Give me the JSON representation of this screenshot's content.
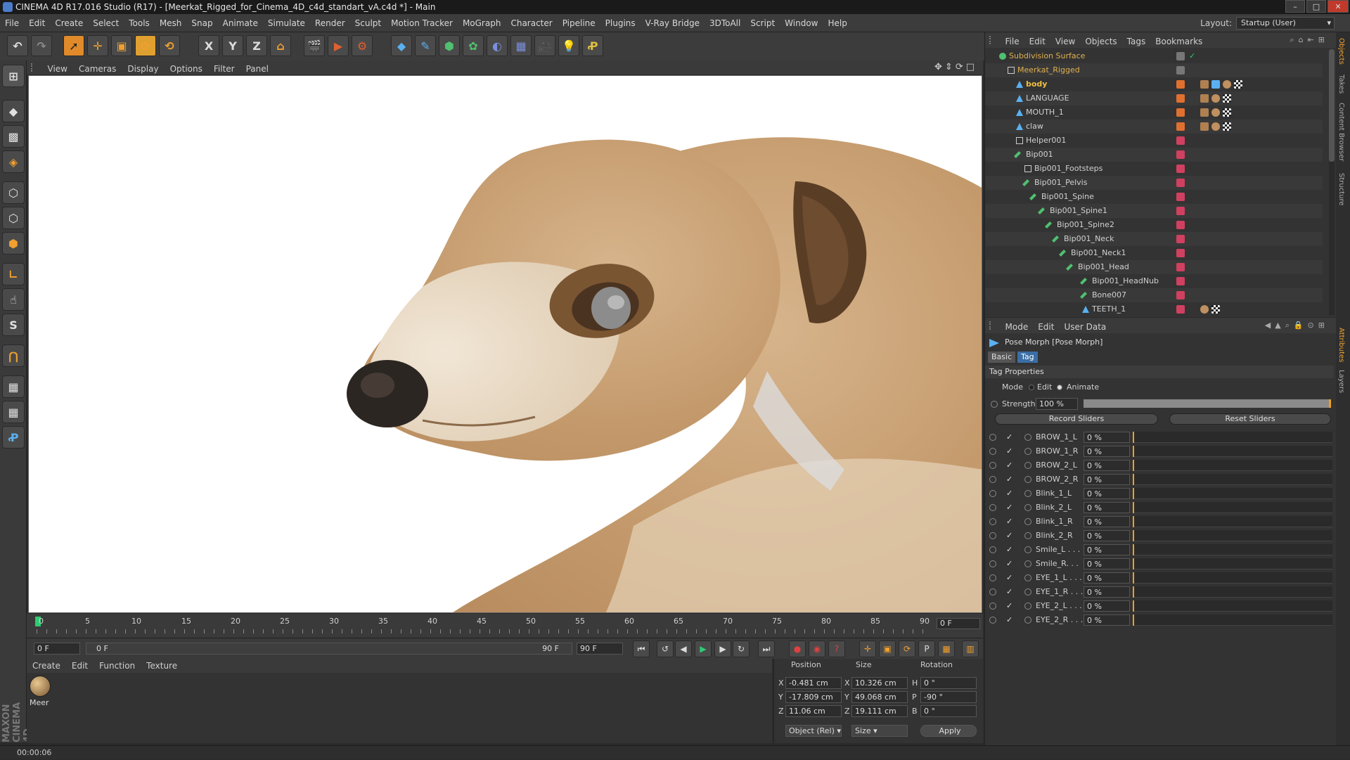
{
  "window": {
    "title": "CINEMA 4D R17.016 Studio (R17) - [Meerkat_Rigged_for_Cinema_4D_c4d_standart_vA.c4d *] - Main"
  },
  "menubar": {
    "items": [
      "File",
      "Edit",
      "Create",
      "Select",
      "Tools",
      "Mesh",
      "Snap",
      "Animate",
      "Simulate",
      "Render",
      "Sculpt",
      "Motion Tracker",
      "MoGraph",
      "Character",
      "Pipeline",
      "Plugins",
      "V-Ray Bridge",
      "3DToAll",
      "Script",
      "Window",
      "Help"
    ],
    "layout_label": "Layout:",
    "layout_value": "Startup (User)"
  },
  "toolbar": {
    "axis_x": "X",
    "axis_y": "Y",
    "axis_z": "Z"
  },
  "viewport": {
    "menu": [
      "View",
      "Cameras",
      "Display",
      "Options",
      "Filter",
      "Panel"
    ]
  },
  "timeline": {
    "ticks": [
      "0",
      "5",
      "10",
      "15",
      "20",
      "25",
      "30",
      "35",
      "40",
      "45",
      "50",
      "55",
      "60",
      "65",
      "70",
      "75",
      "80",
      "85",
      "90"
    ],
    "current_frame": "0 F"
  },
  "anim": {
    "start": "0 F",
    "range_start": "0 F",
    "range_end": "90 F",
    "end": "90 F"
  },
  "material_manager": {
    "menu": [
      "Create",
      "Edit",
      "Function",
      "Texture"
    ],
    "material_name": "Meer"
  },
  "coordinates": {
    "headers": [
      "Position",
      "Size",
      "Rotation"
    ],
    "rows": [
      {
        "axis": "X",
        "pos": "-0.481 cm",
        "saxis": "X",
        "size": "10.326 cm",
        "raxis": "H",
        "rot": "0 °"
      },
      {
        "axis": "Y",
        "pos": "-17.809 cm",
        "saxis": "Y",
        "size": "49.068 cm",
        "raxis": "P",
        "rot": "-90 °"
      },
      {
        "axis": "Z",
        "pos": "11.06 cm",
        "saxis": "Z",
        "size": "19.111 cm",
        "raxis": "B",
        "rot": "0 °"
      }
    ],
    "mode": "Object (Rel)",
    "size_mode": "Size",
    "apply": "Apply"
  },
  "status": {
    "time": "00:00:06"
  },
  "object_manager": {
    "menu": [
      "File",
      "Edit",
      "View",
      "Objects",
      "Tags",
      "Bookmarks"
    ],
    "objects": [
      {
        "name": "Subdivision Surface",
        "color": "#e0b050"
      },
      {
        "name": "Meerkat_Rigged",
        "color": "#e0b050"
      },
      {
        "name": "body",
        "color": "#f0c040"
      },
      {
        "name": "LANGUAGE",
        "color": "#d0d0d0"
      },
      {
        "name": "MOUTH_1",
        "color": "#d0d0d0"
      },
      {
        "name": "claw",
        "color": "#d0d0d0"
      },
      {
        "name": "Helper001",
        "color": "#d0d0d0"
      },
      {
        "name": "Bip001",
        "color": "#d0d0d0"
      },
      {
        "name": "Bip001_Footsteps",
        "color": "#d0d0d0"
      },
      {
        "name": "Bip001_Pelvis",
        "color": "#d0d0d0"
      },
      {
        "name": "Bip001_Spine",
        "color": "#d0d0d0"
      },
      {
        "name": "Bip001_Spine1",
        "color": "#d0d0d0"
      },
      {
        "name": "Bip001_Spine2",
        "color": "#d0d0d0"
      },
      {
        "name": "Bip001_Neck",
        "color": "#d0d0d0"
      },
      {
        "name": "Bip001_Neck1",
        "color": "#d0d0d0"
      },
      {
        "name": "Bip001_Head",
        "color": "#d0d0d0"
      },
      {
        "name": "Bip001_HeadNub",
        "color": "#d0d0d0"
      },
      {
        "name": "Bone007",
        "color": "#d0d0d0"
      },
      {
        "name": "TEETH_1",
        "color": "#d0d0d0"
      }
    ]
  },
  "side_tabs": [
    "Objects",
    "Takes",
    "Content Browser",
    "Structure",
    "Attributes",
    "Layers"
  ],
  "attributes": {
    "menu": [
      "Mode",
      "Edit",
      "User Data"
    ],
    "title": "Pose Morph [Pose Morph]",
    "tabs": [
      "Basic",
      "Tag"
    ],
    "section": "Tag Properties",
    "mode_label": "Mode",
    "mode_edit": "Edit",
    "mode_animate": "Animate",
    "strength_label": "Strength",
    "strength_value": "100 %",
    "record_sliders": "Record Sliders",
    "reset_sliders": "Reset Sliders",
    "morphs": [
      {
        "name": "BROW_1_L",
        "value": "0 %"
      },
      {
        "name": "BROW_1_R",
        "value": "0 %"
      },
      {
        "name": "BROW_2_L",
        "value": "0 %"
      },
      {
        "name": "BROW_2_R",
        "value": "0 %"
      },
      {
        "name": "Blink_1_L",
        "value": "0 %"
      },
      {
        "name": "Blink_2_L",
        "value": "0 %"
      },
      {
        "name": "Blink_1_R",
        "value": "0 %"
      },
      {
        "name": "Blink_2_R",
        "value": "0 %"
      },
      {
        "name": "Smile_L . . .",
        "value": "0 %"
      },
      {
        "name": "Smile_R. . .",
        "value": "0 %"
      },
      {
        "name": "EYE_1_L . . .",
        "value": "0 %"
      },
      {
        "name": "EYE_1_R . . .",
        "value": "0 %"
      },
      {
        "name": "EYE_2_L . . .",
        "value": "0 %"
      },
      {
        "name": "EYE_2_R . . .",
        "value": "0 %"
      }
    ]
  }
}
